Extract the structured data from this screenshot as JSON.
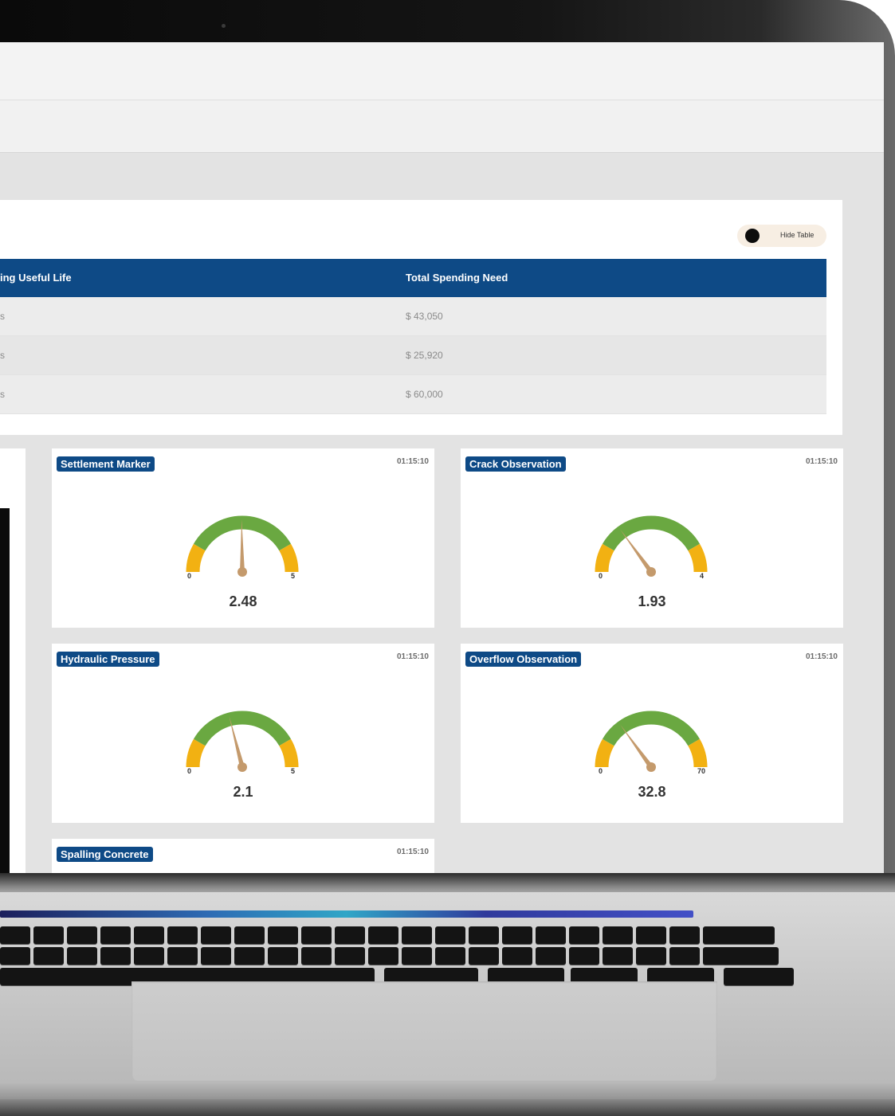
{
  "table": {
    "toggle_label": "Hide Table",
    "columns": [
      "ing Useful Life",
      "Total Spending Need"
    ],
    "rows": [
      {
        "life": "s",
        "spend": "$ 43,050"
      },
      {
        "life": "s",
        "spend": "$ 25,920"
      },
      {
        "life": "s",
        "spend": "$ 60,000"
      }
    ]
  },
  "gauges": [
    {
      "title": "Settlement Marker",
      "time": "01:15:10",
      "min": "0",
      "max": "5",
      "value": "2.48",
      "fraction": 0.496
    },
    {
      "title": "Crack Observation",
      "time": "01:15:10",
      "min": "0",
      "max": "4",
      "value": "1.93",
      "fraction": 0.3
    },
    {
      "title": "Hydraulic Pressure",
      "time": "01:15:10",
      "min": "0",
      "max": "5",
      "value": "2.1",
      "fraction": 0.42
    },
    {
      "title": "Overflow Observation",
      "time": "01:15:10",
      "min": "0",
      "max": "70",
      "value": "32.8",
      "fraction": 0.3
    },
    {
      "title": "Spalling Concrete",
      "time": "01:15:10"
    }
  ],
  "colors": {
    "header_blue": "#0e4a86",
    "gauge_green": "#6aa841",
    "gauge_amber": "#f2b112",
    "needle": "#c49a6c"
  }
}
